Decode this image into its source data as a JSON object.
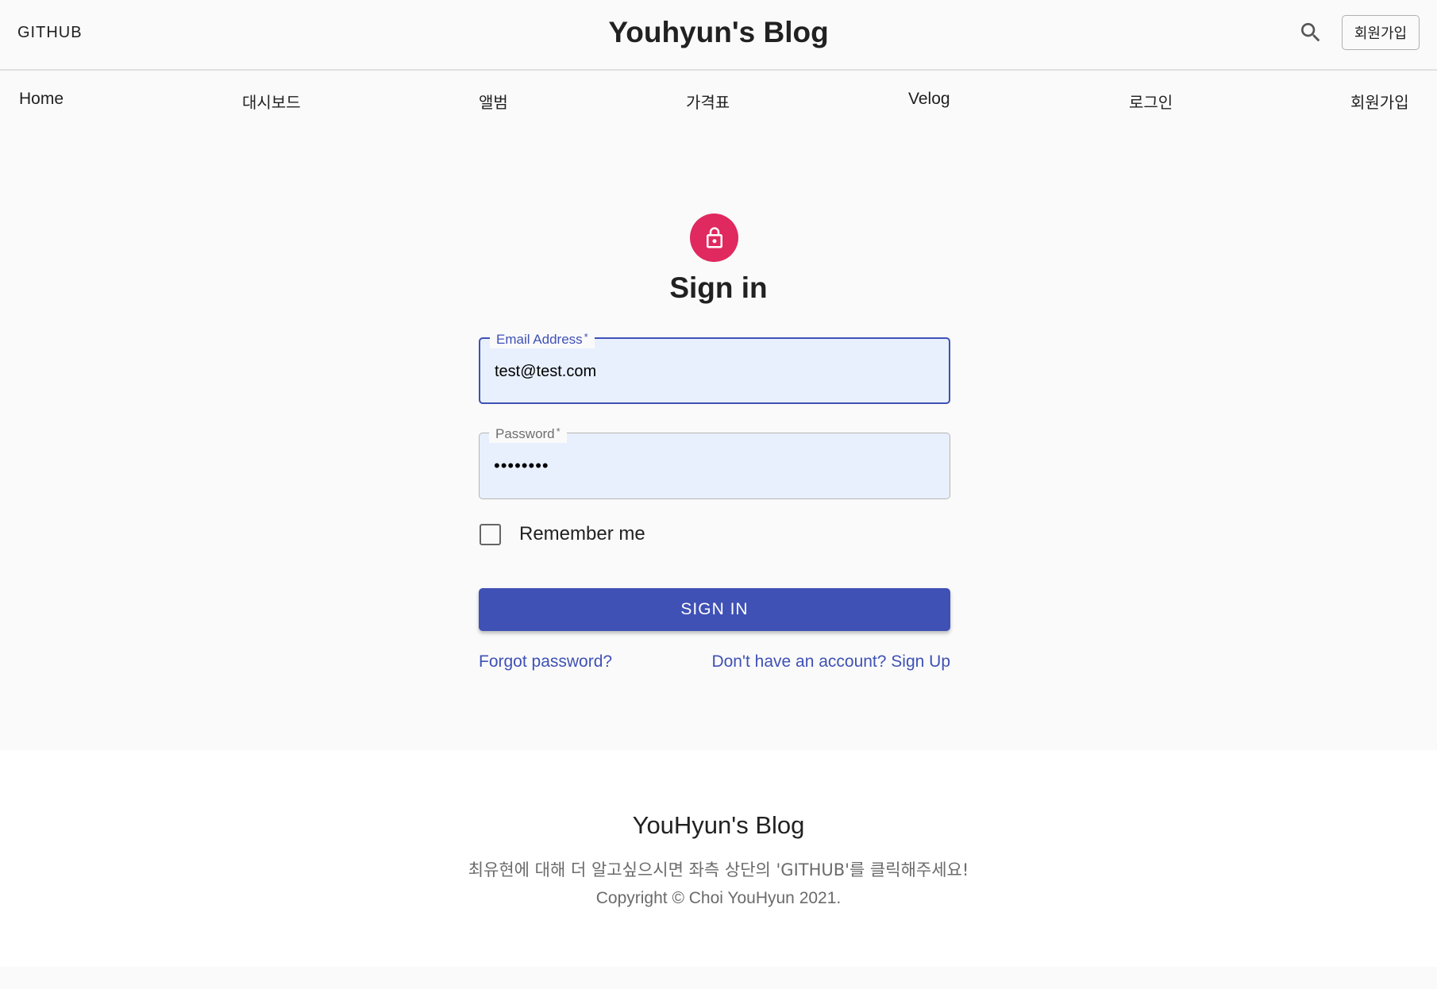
{
  "header": {
    "github_label": "GITHUB",
    "site_title": "Youhyun's Blog",
    "signup_button": "회원가입",
    "search_icon": "search-icon"
  },
  "nav": {
    "items": [
      {
        "label": "Home"
      },
      {
        "label": "대시보드"
      },
      {
        "label": "앨범"
      },
      {
        "label": "가격표"
      },
      {
        "label": "Velog"
      },
      {
        "label": "로그인"
      },
      {
        "label": "회원가입"
      }
    ]
  },
  "signin": {
    "icon": "lock-icon",
    "title": "Sign in",
    "email": {
      "label": "Email Address",
      "required_mark": "*",
      "value": "test@test.com"
    },
    "password": {
      "label": "Password",
      "required_mark": "*",
      "value": "••••••••"
    },
    "remember_label": "Remember me",
    "remember_checked": false,
    "submit_label": "SIGN IN",
    "forgot_link": "Forgot password?",
    "signup_link": "Don't have an account? Sign Up"
  },
  "footer": {
    "title": "YouHyun's Blog",
    "description": "최유현에 대해 더 알고싶으시면 좌측 상단의 'GITHUB'를 클릭해주세요!",
    "copyright": "Copyright © Choi YouHyun 2021."
  },
  "colors": {
    "primary": "#3f51b5",
    "avatar": "#e0295f",
    "input_fill": "#e8f0fe",
    "page_bg": "#fafafa",
    "footer_bg": "#ffffff"
  }
}
